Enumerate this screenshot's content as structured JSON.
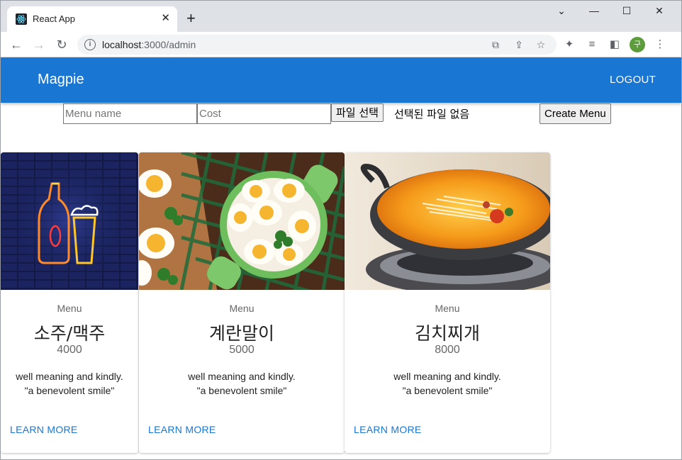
{
  "browser": {
    "tab_title": "React App",
    "url_host": "localhost",
    "url_path": ":3000/admin",
    "profile_initial": "구"
  },
  "appbar": {
    "brand": "Magpie",
    "logout_label": "LOGOUT"
  },
  "form": {
    "menu_name_placeholder": "Menu name",
    "cost_placeholder": "Cost",
    "file_button_label": "파일 선택",
    "file_status": "선택된 파일 없음",
    "create_button_label": "Create Menu"
  },
  "cards": [
    {
      "overline": "Menu",
      "title": "소주/맥주",
      "cost": "4000",
      "desc_line1": "well meaning and kindly.",
      "desc_line2": "\"a benevolent smile\"",
      "action": "LEARN MORE",
      "image": "neon-beer-bottle-and-glass"
    },
    {
      "overline": "Menu",
      "title": "계란말이",
      "cost": "5000",
      "desc_line1": "well meaning and kindly.",
      "desc_line2": "\"a benevolent smile\"",
      "action": "LEARN MORE",
      "image": "boiled-eggs-in-bowl"
    },
    {
      "overline": "Menu",
      "title": "김치찌개",
      "cost": "8000",
      "desc_line1": "well meaning and kindly.",
      "desc_line2": "\"a benevolent smile\"",
      "action": "LEARN MORE",
      "image": "stew-pot-on-burner"
    }
  ],
  "icons": {
    "back": "arrow-left-icon",
    "forward": "arrow-right-icon",
    "reload": "reload-icon",
    "translate": "translate-icon",
    "share": "share-icon",
    "star": "star-icon",
    "extensions": "puzzle-icon",
    "media": "media-icon",
    "sidepanel": "side-panel-icon",
    "menu": "kebab-menu-icon"
  },
  "colors": {
    "primary": "#1976d2",
    "tabstrip": "#dee1e6"
  }
}
